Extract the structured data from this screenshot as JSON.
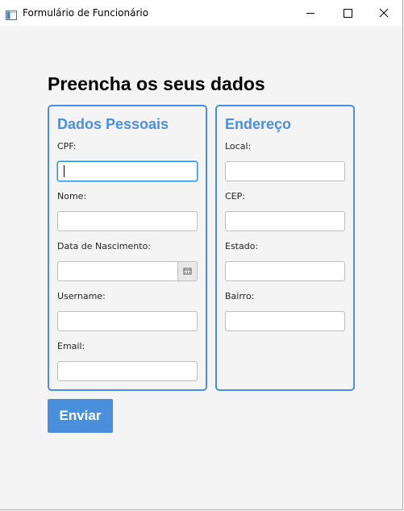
{
  "window": {
    "title": "Formulário de Funcionário",
    "minimize_icon": "minimize-icon",
    "maximize_icon": "maximize-icon",
    "close_icon": "close-icon"
  },
  "form": {
    "heading": "Preencha os seus dados",
    "personal": {
      "title": "Dados Pessoais",
      "fields": {
        "cpf": {
          "label": "CPF:",
          "value": ""
        },
        "nome": {
          "label": "Nome:",
          "value": ""
        },
        "nascimento": {
          "label": "Data de Nascimento:",
          "value": "",
          "icon": "calendar-icon"
        },
        "username": {
          "label": "Username:",
          "value": ""
        },
        "email": {
          "label": "Email:",
          "value": ""
        }
      }
    },
    "address": {
      "title": "Endereço",
      "fields": {
        "local": {
          "label": "Local:",
          "value": ""
        },
        "cep": {
          "label": "CEP:",
          "value": ""
        },
        "estado": {
          "label": "Estado:",
          "value": ""
        },
        "bairro": {
          "label": "Bairro:",
          "value": ""
        }
      }
    },
    "submit_label": "Enviar"
  },
  "colors": {
    "accent": "#4a8fdc",
    "focus": "#2a8cd2",
    "background": "#f4f4f4"
  }
}
